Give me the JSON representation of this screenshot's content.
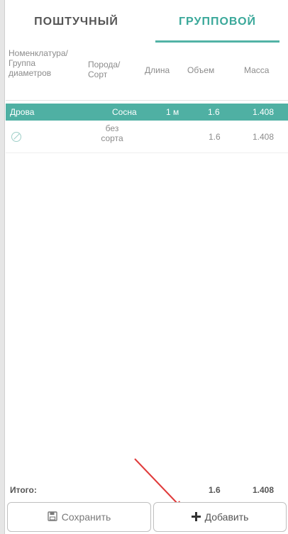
{
  "tabs": [
    {
      "label": "поштучный",
      "active": false
    },
    {
      "label": "групповой",
      "active": true
    }
  ],
  "columns": {
    "nomenclature": "Номенклатура/ Группа диаметров",
    "breed": "Порода/ Сорт",
    "length": "Длина",
    "volume": "Объем",
    "mass": "Масса"
  },
  "rows": [
    {
      "nomenclature": "Дрова",
      "breed": "Сосна",
      "length": "1 м",
      "volume": "1.6",
      "mass": "1.408",
      "selected": true
    },
    {
      "nomenclature": "",
      "breed": "без сорта",
      "length": "",
      "volume": "1.6",
      "mass": "1.408",
      "selected": false,
      "icon": "no-entry-icon"
    }
  ],
  "totals": {
    "label": "Итого:",
    "volume": "1.6",
    "mass": "1.408"
  },
  "buttons": {
    "save": {
      "label": "Сохранить",
      "icon": "floppy-disk-icon"
    },
    "add": {
      "label": "Добавить",
      "icon": "plus-icon"
    }
  },
  "colors": {
    "accent": "#4fb0a3",
    "annotation_arrow": "#e03b3b"
  }
}
